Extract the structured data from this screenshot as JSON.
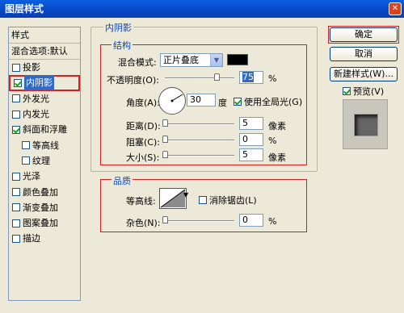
{
  "window": {
    "title": "图层样式"
  },
  "left": {
    "header": "样式",
    "blend": "混合选项:默认",
    "items": [
      {
        "label": "投影",
        "checked": false,
        "sub": false,
        "selected": false
      },
      {
        "label": "内阴影",
        "checked": true,
        "sub": false,
        "selected": true
      },
      {
        "label": "外发光",
        "checked": false,
        "sub": false,
        "selected": false
      },
      {
        "label": "内发光",
        "checked": false,
        "sub": false,
        "selected": false
      },
      {
        "label": "斜面和浮雕",
        "checked": true,
        "sub": false,
        "selected": false
      },
      {
        "label": "等高线",
        "checked": false,
        "sub": true,
        "selected": false
      },
      {
        "label": "纹理",
        "checked": false,
        "sub": true,
        "selected": false
      },
      {
        "label": "光泽",
        "checked": false,
        "sub": false,
        "selected": false
      },
      {
        "label": "颜色叠加",
        "checked": false,
        "sub": false,
        "selected": false
      },
      {
        "label": "渐变叠加",
        "checked": false,
        "sub": false,
        "selected": false
      },
      {
        "label": "图案叠加",
        "checked": false,
        "sub": false,
        "selected": false
      },
      {
        "label": "描边",
        "checked": false,
        "sub": false,
        "selected": false
      }
    ]
  },
  "inner_shadow": {
    "title": "内阴影",
    "structure": {
      "title": "结构",
      "blend_mode_label": "混合模式:",
      "blend_mode_value": "正片叠底",
      "opacity_label": "不透明度(O):",
      "opacity_value": "75",
      "opacity_unit": "%",
      "opacity_level": 0.75,
      "angle_label": "角度(A):",
      "angle_value": "30",
      "angle_unit": "度",
      "global_light_label": "使用全局光(G)",
      "global_light_checked": true,
      "distance_label": "距离(D):",
      "distance_value": "5",
      "distance_unit": "像素",
      "choke_label": "阻塞(C):",
      "choke_value": "0",
      "choke_unit": "%",
      "size_label": "大小(S):",
      "size_value": "5",
      "size_unit": "像素"
    },
    "quality": {
      "title": "品质",
      "contour_label": "等高线:",
      "antialias_label": "消除锯齿(L)",
      "antialias_checked": false,
      "noise_label": "杂色(N):",
      "noise_value": "0",
      "noise_unit": "%"
    }
  },
  "buttons": {
    "ok": "确定",
    "cancel": "取消",
    "new_style": "新建样式(W)..."
  },
  "preview": {
    "label": "预览(V)",
    "checked": true
  },
  "colors": {
    "shadow_color": "#000000",
    "highlight": "#d42020",
    "accent": "#316ac5"
  }
}
